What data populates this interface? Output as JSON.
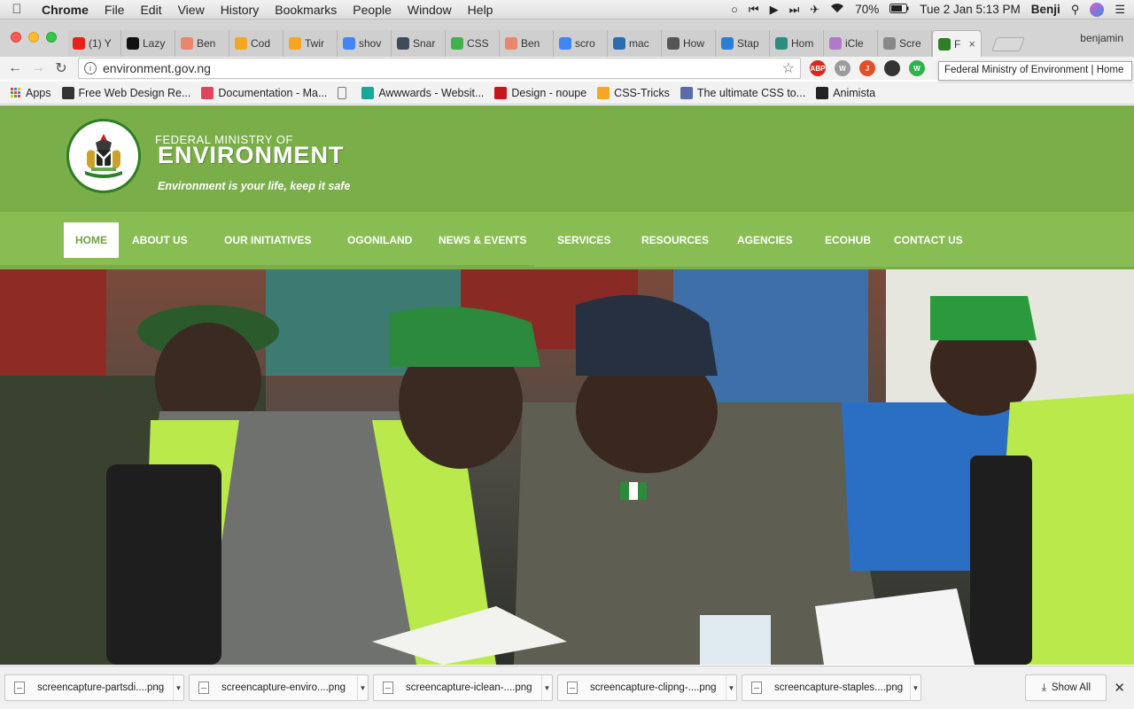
{
  "menubar": {
    "app": "Chrome",
    "items": [
      "File",
      "Edit",
      "View",
      "History",
      "Bookmarks",
      "People",
      "Window",
      "Help"
    ],
    "battery": "70%",
    "clock": "Tue 2 Jan  5:13 PM",
    "user": "Benji"
  },
  "tabs": [
    {
      "label": "(1) Y",
      "icon": "youtube-icon",
      "color": "#e62117"
    },
    {
      "label": "Lazy",
      "icon": "tl-icon",
      "color": "#111111"
    },
    {
      "label": "Ben",
      "icon": "figma-icon",
      "color": "#e9866b"
    },
    {
      "label": "Cod",
      "icon": "star-icon",
      "color": "#f5a623"
    },
    {
      "label": "Twir",
      "icon": "star-icon",
      "color": "#f5a623"
    },
    {
      "label": "shov",
      "icon": "google-icon",
      "color": "#4285f4"
    },
    {
      "label": "Snar",
      "icon": "snap-icon",
      "color": "#3d4b5c"
    },
    {
      "label": "CSS",
      "icon": "css-icon",
      "color": "#41b14b"
    },
    {
      "label": "Ben",
      "icon": "figma-icon",
      "color": "#e9866b"
    },
    {
      "label": "scro",
      "icon": "google-icon",
      "color": "#4285f4"
    },
    {
      "label": "mac",
      "icon": "bracket-icon",
      "color": "#2b6cb0"
    },
    {
      "label": "How",
      "icon": "x-icon",
      "color": "#555555"
    },
    {
      "label": "Stap",
      "icon": "swoosh-icon",
      "color": "#2a7fd4"
    },
    {
      "label": "Hom",
      "icon": "globe-icon",
      "color": "#2c8c7e"
    },
    {
      "label": "iCle",
      "icon": "jsfiddle-icon",
      "color": "#b07ac9"
    },
    {
      "label": "Scre",
      "icon": "camera-icon",
      "color": "#888888"
    },
    {
      "label": "F",
      "icon": "coat-of-arms-icon",
      "color": "#2f7d24",
      "active": true
    }
  ],
  "profile": "benjamin",
  "toolbar": {
    "url": "environment.gov.ng",
    "tooltip": "Federal Ministry of Environment | Home",
    "extensions": [
      {
        "name": "adblock-plus-icon",
        "label": "ABP",
        "color": "#d52b1e"
      },
      {
        "name": "wordpress-icon",
        "label": "W",
        "color": "#9b9b9b"
      },
      {
        "name": "joomla-icon",
        "label": "J",
        "color": "#e44d26"
      },
      {
        "name": "settings-icon",
        "label": "",
        "color": "#333333"
      },
      {
        "name": "wordpress-green-icon",
        "label": "W",
        "color": "#2fb24c"
      }
    ]
  },
  "bookmarks": [
    {
      "label": "Apps",
      "icon": "apps-grid-icon"
    },
    {
      "label": "Free Web Design Re...",
      "icon": "tn-icon",
      "color": "#333333"
    },
    {
      "label": "Documentation - Ma...",
      "icon": "m-icon",
      "color": "#e2445c"
    },
    {
      "label": "",
      "icon": "page-icon",
      "color": "#ffffff"
    },
    {
      "label": "Awwwards - Websit...",
      "icon": "awwwards-icon",
      "color": "#16a99a"
    },
    {
      "label": "Design - noupe",
      "icon": "noupe-icon",
      "color": "#c4161c"
    },
    {
      "label": "CSS-Tricks",
      "icon": "star-icon",
      "color": "#f5a623"
    },
    {
      "label": "The ultimate CSS to...",
      "icon": "folder-icon",
      "color": "#5b6aa8"
    },
    {
      "label": "Animista",
      "icon": "animista-icon",
      "color": "#222222"
    }
  ],
  "site": {
    "subtitle": "FEDERAL MINISTRY OF",
    "title": "ENVIRONMENT",
    "tagline": "Environment is your life, keep it safe",
    "nav": [
      "HOME",
      "ABOUT US",
      "OUR INITIATIVES",
      "OGONILAND",
      "NEWS & EVENTS",
      "SERVICES",
      "RESOURCES",
      "AGENCIES",
      "ECOHUB",
      "CONTACT US"
    ],
    "nav_active": "HOME",
    "colors": {
      "header": "#7aae48",
      "nav": "#87bd52",
      "active_text": "#6ea443"
    }
  },
  "downloads": [
    "screencapture-partsdi....png",
    "screencapture-enviro....png",
    "screencapture-iclean-....png",
    "screencapture-clipng-....png",
    "screencapture-staples....png"
  ],
  "downloads_show_all": "Show All"
}
